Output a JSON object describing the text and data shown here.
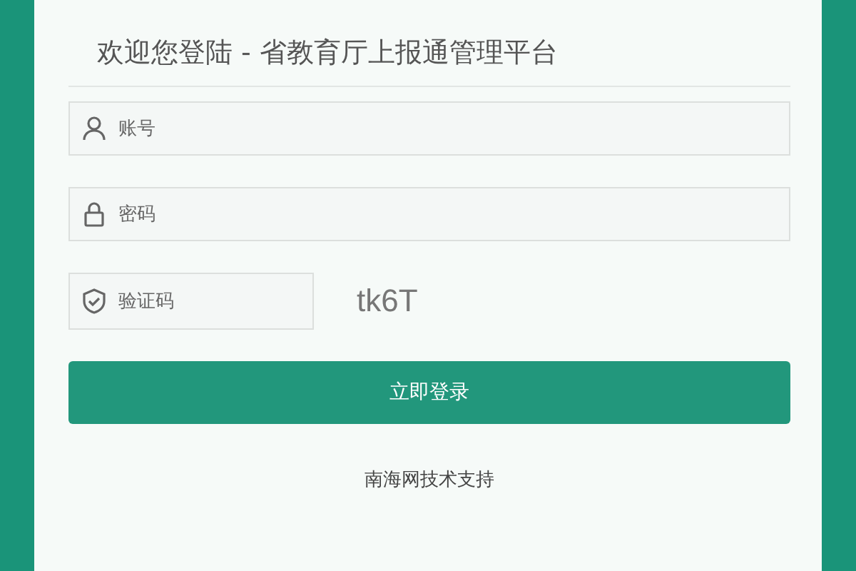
{
  "title": "欢迎您登陆 - 省教育厅上报通管理平台",
  "fields": [
    {
      "kind": "user",
      "placeholder": "账号"
    },
    {
      "kind": "lock",
      "placeholder": "密码"
    }
  ],
  "captcha": {
    "placeholder": "验证码",
    "code": "tk6T"
  },
  "login_button": "立即登录",
  "footer": "南海网技术支持"
}
